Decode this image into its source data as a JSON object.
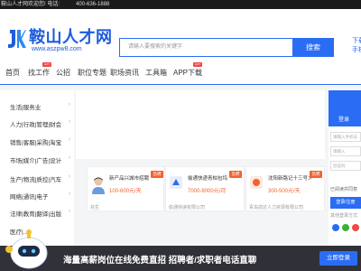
{
  "topbar": {
    "welcome": "鞍山人才网欢迎您! 电话:",
    "phone": "400-636-1888"
  },
  "header": {
    "logo_title": "鞍山人才网",
    "logo_url": "www.aszpw8.com",
    "search_placeholder": "请输入要搜索的关键字",
    "search_button": "搜索",
    "download_1": "下载",
    "download_2": "手机"
  },
  "nav": {
    "items": [
      {
        "label": "首页",
        "hot": false
      },
      {
        "label": "找工作",
        "hot": true
      },
      {
        "label": "公招",
        "hot": false
      },
      {
        "label": "职位专题",
        "hot": false
      },
      {
        "label": "职场资讯",
        "hot": false
      },
      {
        "label": "工具箱",
        "hot": false
      },
      {
        "label": "APP下载",
        "hot": true
      }
    ],
    "hot_label": "HOT"
  },
  "categories": [
    "生活|服务业",
    "人力|行政|管理|财会",
    "销售|客服|采购|淘宝",
    "市场|媒介|广告|设计",
    "生产|物流|质控|汽车",
    "网络|通讯|电子",
    "法律|教育|翻译|出版",
    "医疗|..."
  ],
  "cards": [
    {
      "title": "新产品兴城市招聘",
      "salary": "100-600元/天",
      "company": "兆生",
      "tag": "急聘"
    },
    {
      "title": "偷通快递青柏包坞",
      "salary": "7000-8000元/月",
      "company": "偷通快递有限公司",
      "tag": "急聘"
    },
    {
      "title": "沈阳新路记十三号大",
      "salary": "300-500元/天",
      "company": "青岛前达人力资源有限公司",
      "tag": "急聘"
    }
  ],
  "login": {
    "title": "登录",
    "user_placeholder": "请输入手机号",
    "pass_placeholder": "请输入",
    "captcha": "验证码",
    "remember": "已阅读并同意",
    "button": "登录/注册",
    "other": "其他登录方式"
  },
  "promo": {
    "text": "海量高薪岗位在线免费直招 招聘者/求职者电话直聊",
    "button": "立即登录"
  },
  "colors": {
    "brand": "#2a6df4",
    "accent": "#f2622e",
    "hot": "#f04848"
  }
}
